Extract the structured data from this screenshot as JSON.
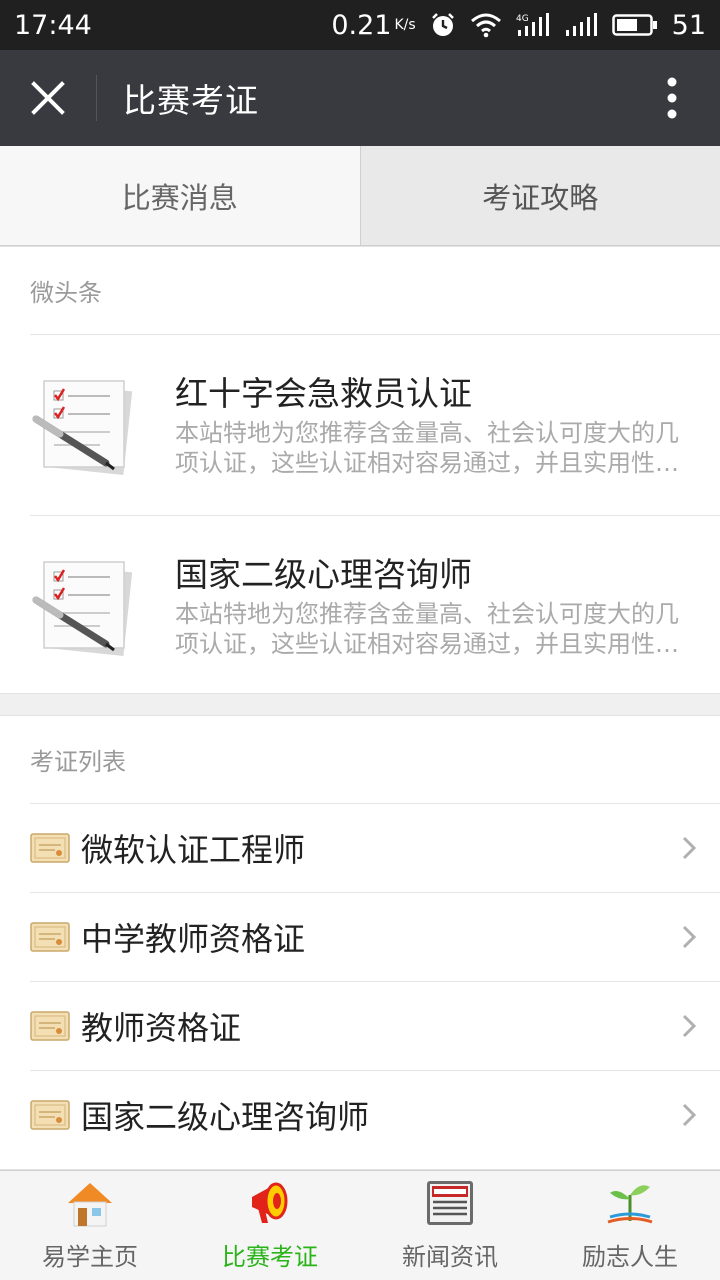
{
  "statusbar": {
    "time": "17:44",
    "speed": "0.21",
    "speed_unit": "K/s",
    "network": "4G",
    "battery": "51"
  },
  "titlebar": {
    "title": "比赛考证"
  },
  "tabs": [
    {
      "label": "比赛消息",
      "active": false
    },
    {
      "label": "考证攻略",
      "active": true
    }
  ],
  "headlines": {
    "section_title": "微头条",
    "items": [
      {
        "title": "红十字会急救员认证",
        "desc": "本站特地为您推荐含金量高、社会认可度大的几项认证，这些认证相对容易通过，并且实用性强，值得一考。"
      },
      {
        "title": "国家二级心理咨询师",
        "desc": "本站特地为您推荐含金量高、社会认可度大的几项认证，这些认证相对容易通过，并且实用性强，值得一考。"
      }
    ]
  },
  "cert_list": {
    "section_title": "考证列表",
    "items": [
      {
        "label": "微软认证工程师"
      },
      {
        "label": "中学教师资格证"
      },
      {
        "label": "教师资格证"
      },
      {
        "label": "国家二级心理咨询师"
      }
    ]
  },
  "bottom_nav": [
    {
      "label": "易学主页",
      "icon": "home-icon",
      "active": false
    },
    {
      "label": "比赛考证",
      "icon": "megaphone-icon",
      "active": true
    },
    {
      "label": "新闻资讯",
      "icon": "newspaper-icon",
      "active": false
    },
    {
      "label": "励志人生",
      "icon": "sprout-icon",
      "active": false
    }
  ],
  "colors": {
    "titlebar": "#393a3f",
    "active_nav": "#2bb41a",
    "statusbar": "#202020"
  }
}
